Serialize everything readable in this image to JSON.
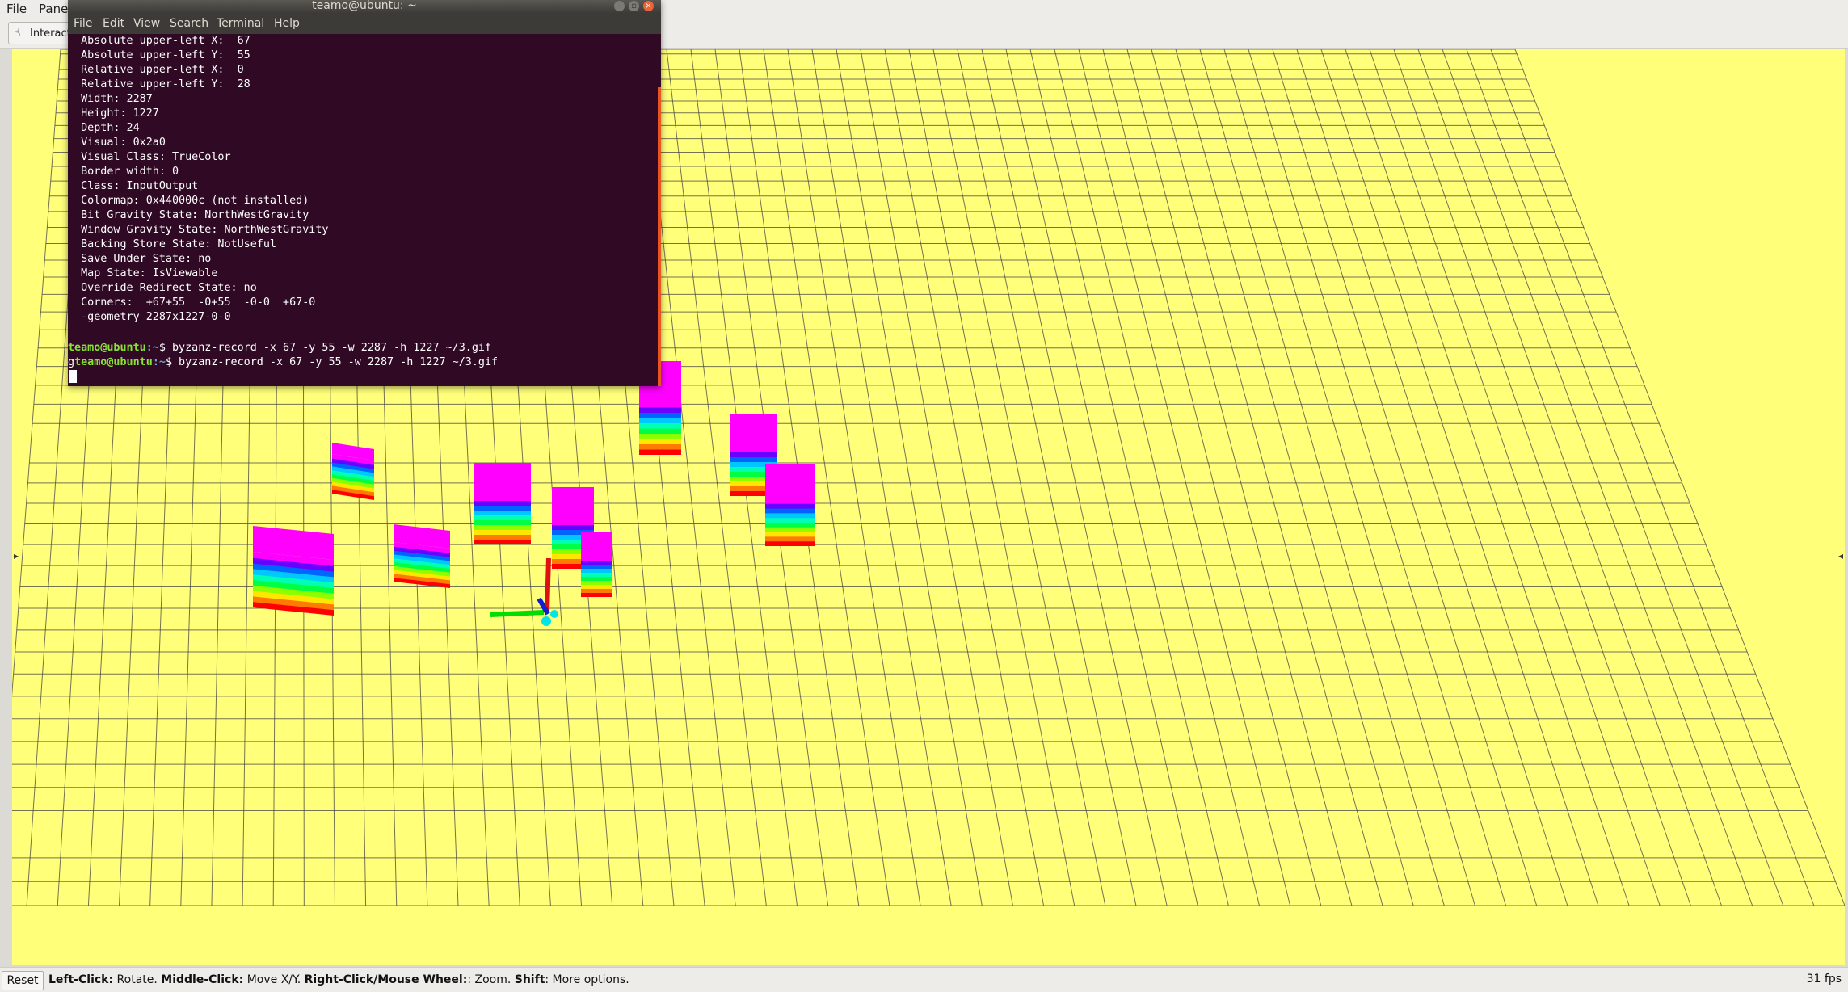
{
  "rviz": {
    "menu": [
      "File",
      "Panels"
    ],
    "toolbar": {
      "interact_label": "Interact"
    },
    "status": {
      "reset_label": "Reset",
      "hint_parts": [
        {
          "bold": "Left-Click:",
          "text": " Rotate. "
        },
        {
          "bold": "Middle-Click:",
          "text": " Move X/Y. "
        },
        {
          "bold": "Right-Click/Mouse Wheel:",
          "text": ": Zoom. "
        },
        {
          "bold": "Shift",
          "text": ": More options."
        }
      ],
      "fps": "31 fps"
    },
    "background_color": "#ffff7a",
    "grid_color": "#444444"
  },
  "terminal": {
    "title": "teamo@ubuntu: ~",
    "menu": [
      "File",
      "Edit",
      "View",
      "Search",
      "Terminal",
      "Help"
    ],
    "lines": [
      "  Absolute upper-left X:  67",
      "  Absolute upper-left Y:  55",
      "  Relative upper-left X:  0",
      "  Relative upper-left Y:  28",
      "  Width: 2287",
      "  Height: 1227",
      "  Depth: 24",
      "  Visual: 0x2a0",
      "  Visual Class: TrueColor",
      "  Border width: 0",
      "  Class: InputOutput",
      "  Colormap: 0x440000c (not installed)",
      "  Bit Gravity State: NorthWestGravity",
      "  Window Gravity State: NorthWestGravity",
      "  Backing Store State: NotUseful",
      "  Save Under State: no",
      "  Map State: IsViewable",
      "  Override Redirect State: no",
      "  Corners:  +67+55  -0+55  -0-0  +67-0",
      "  -geometry 2287x1227-0-0",
      ""
    ],
    "prompts": [
      {
        "prefix": "",
        "user": "teamo@ubuntu",
        "path": ":~",
        "cmd": "$ byzanz-record -x 67 -y 55 -w 2287 -h 1227 ~/3.gif"
      },
      {
        "prefix": "g",
        "user": "teamo@ubuntu",
        "path": ":~",
        "cmd": "$ byzanz-record -x 67 -y 55 -w 2287 -h 1227 ~/3.gif"
      }
    ]
  }
}
